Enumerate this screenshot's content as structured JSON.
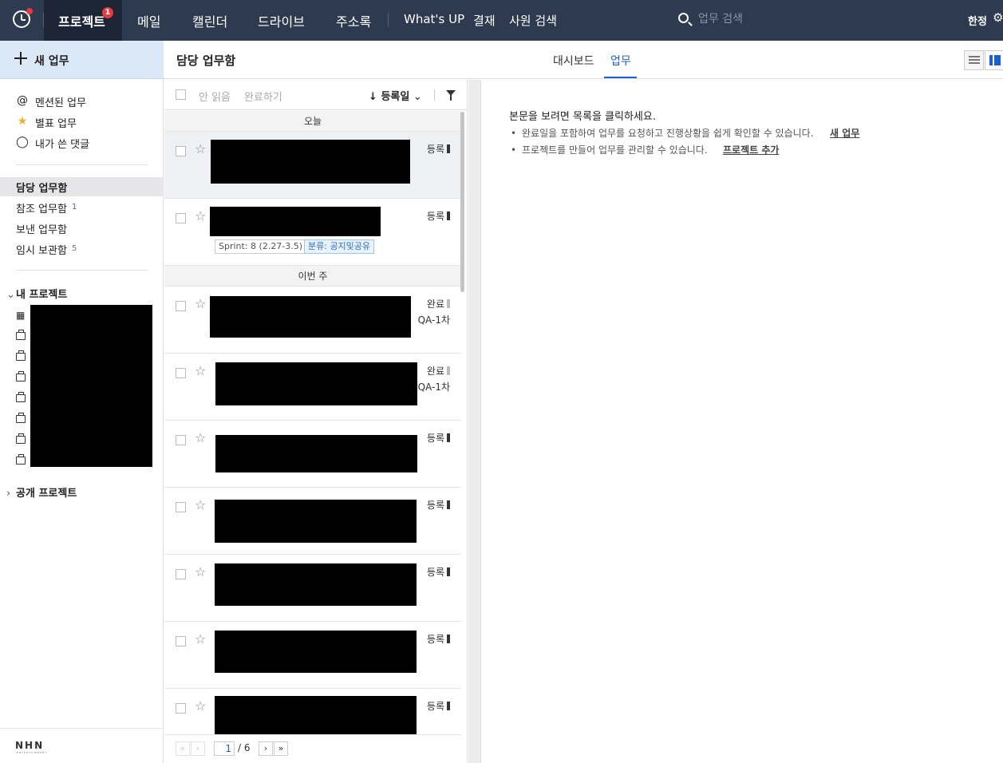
{
  "topnav": {
    "items": [
      "프로젝트",
      "메일",
      "캘린더",
      "드라이브",
      "주소록",
      "What's UP",
      "결재",
      "사원 검색"
    ],
    "notification_count": "1",
    "search_placeholder": "업무 검색",
    "language": "한정"
  },
  "sidebar": {
    "new_task": "새 업무",
    "links": [
      {
        "icon": "at-icon",
        "label": "멘션된 업무"
      },
      {
        "icon": "star-icon",
        "label": "별표 업무"
      },
      {
        "icon": "comment-icon",
        "label": "내가 쓴 댓글"
      }
    ],
    "boxes": [
      {
        "label": "담당 업무함",
        "count": ""
      },
      {
        "label": "참조 업무함",
        "count": "1"
      },
      {
        "label": "보낸 업무함",
        "count": ""
      },
      {
        "label": "임시 보관함",
        "count": "5"
      }
    ],
    "my_projects": "내 프로젝트",
    "public_projects": "공개 프로젝트",
    "logo": "NHN",
    "logo_sub": "ENTERTAINMENT"
  },
  "content": {
    "title": "담당 업무함",
    "tabs": [
      "대시보드",
      "업무"
    ]
  },
  "list": {
    "toolbar": {
      "unread": "안 읽음",
      "complete": "완료하기",
      "sort": "등록일"
    },
    "groups": [
      "오늘",
      "이번 주"
    ],
    "items": [
      {
        "status": "등록",
        "tag1": "",
        "tag2": ""
      },
      {
        "status": "등록",
        "tag1": "Sprint: 8 (2.27-3.5)",
        "tag2": "분류: 공지및공유"
      },
      {
        "status": "완료",
        "sub": "QA-1차"
      },
      {
        "status": "완료",
        "sub": "QA-1차"
      },
      {
        "status": "등록"
      },
      {
        "status": "등록"
      },
      {
        "status": "등록"
      },
      {
        "status": "등록"
      },
      {
        "status": "등록"
      }
    ],
    "pager": {
      "current": "1",
      "total": "/ 6"
    }
  },
  "detail": {
    "message": "본문을 보려면 목록을 클릭하세요.",
    "bullets": [
      {
        "text": "완료일을 포함하여 업무를 요청하고 진행상황을 쉽게 확인할 수 있습니다.",
        "link": "새 업무"
      },
      {
        "text": "프로젝트를 만들어 업무를 관리할 수 있습니다.",
        "link": "프로젝트 추가"
      }
    ]
  }
}
